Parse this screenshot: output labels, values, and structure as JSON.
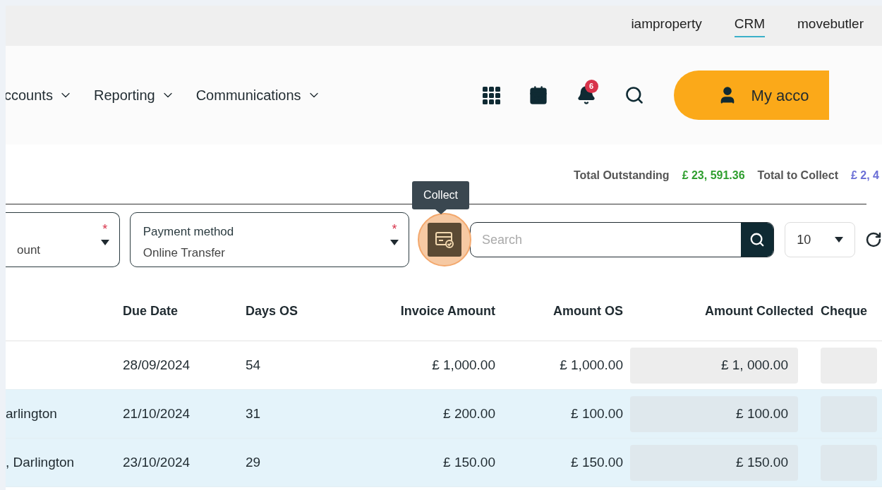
{
  "top_links": [
    {
      "label": "iamproperty",
      "selected": false
    },
    {
      "label": "CRM",
      "selected": true
    },
    {
      "label": "movebutler",
      "selected": false
    }
  ],
  "nav": [
    {
      "label": "ccounts"
    },
    {
      "label": "Reporting"
    },
    {
      "label": "Communications"
    }
  ],
  "notifications": {
    "count": "6"
  },
  "account_button": {
    "label": "My acco"
  },
  "totals": [
    {
      "label": "Total Outstanding",
      "value": "£ 23, 591.36",
      "color": "#2e9e2e"
    },
    {
      "label": "Total to Collect",
      "value": "£ 2, 4",
      "color": "#6b6fd6"
    }
  ],
  "filters": [
    {
      "value": "ount",
      "required": "*"
    },
    {
      "label": "Payment method",
      "value": "Online Transfer",
      "required": "*"
    }
  ],
  "tooltip": "Collect",
  "search": {
    "placeholder": "Search"
  },
  "page_size": "10",
  "table": {
    "columns": [
      "",
      "Due Date",
      "Days OS",
      "Invoice Amount",
      "Amount OS",
      "Amount Collected",
      "Cheque"
    ],
    "rows": [
      {
        "cells": [
          "",
          "28/09/2024",
          "54",
          "£ 1,000.00",
          "£ 1,000.00",
          "£ 1, 000.00",
          ""
        ],
        "selected": false
      },
      {
        "cells": [
          "arlington",
          "21/10/2024",
          "31",
          "£ 200.00",
          "£ 100.00",
          "£ 100.00",
          ""
        ],
        "selected": true
      },
      {
        "cells": [
          ", Darlington",
          "23/10/2024",
          "29",
          "£ 150.00",
          "£ 150.00",
          "£ 150.00",
          ""
        ],
        "selected": true
      }
    ]
  }
}
